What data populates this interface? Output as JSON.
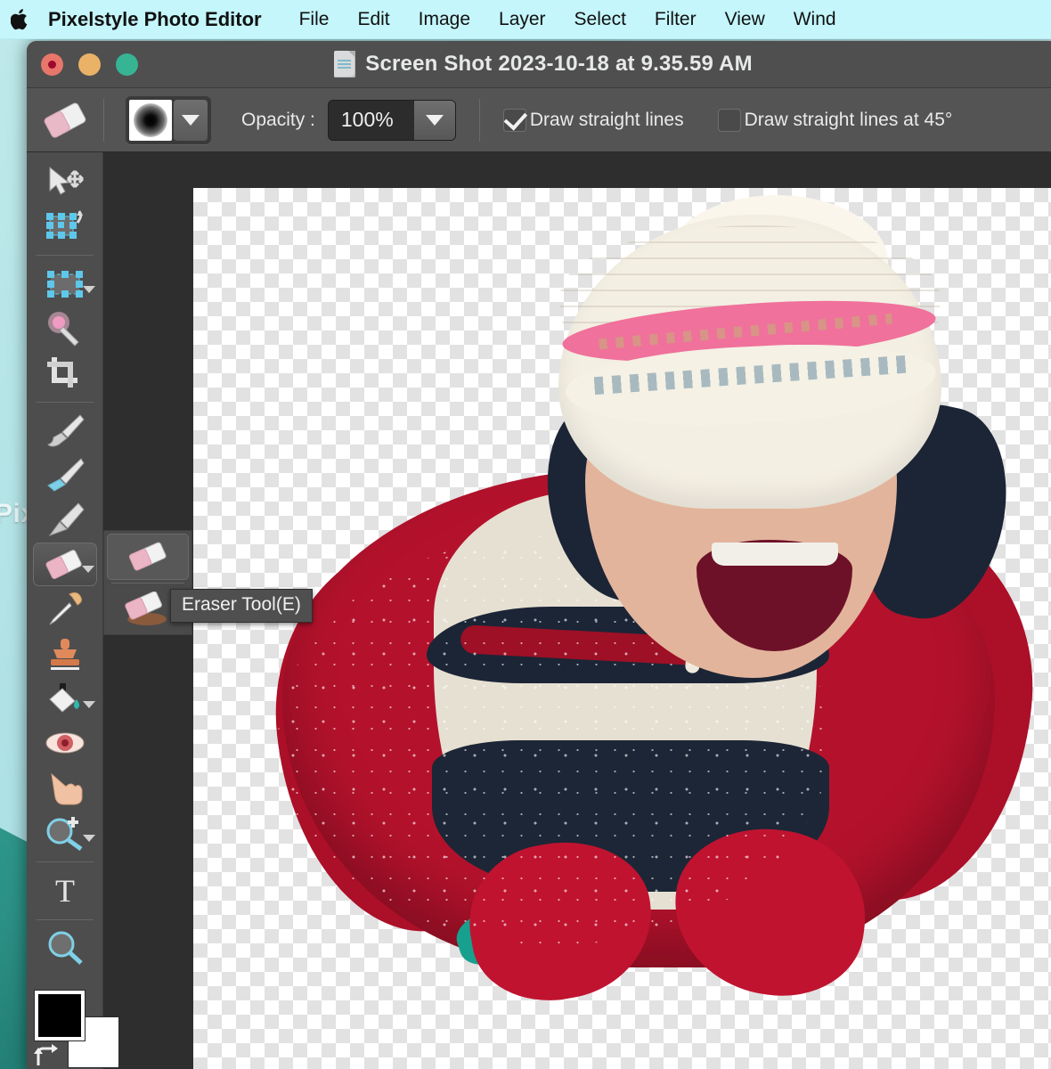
{
  "menubar": {
    "apple_icon": "apple-logo-icon",
    "app_name": "Pixelstyle Photo Editor",
    "items": [
      "File",
      "Edit",
      "Image",
      "Layer",
      "Select",
      "Filter",
      "View",
      "Wind"
    ]
  },
  "desktop": {
    "background_word": "Pix",
    "accent_color": "#c4f6fb"
  },
  "window": {
    "title": "Screen Shot 2023-10-18 at 9.35.59 AM",
    "doc_icon": "document-icon",
    "traffic_lights": {
      "close": "close-button",
      "minimize": "minimize-button",
      "zoom": "zoom-button",
      "close_color": "#e8766b",
      "minimize_color": "#e9b267",
      "zoom_color": "#36b493"
    }
  },
  "options_bar": {
    "active_tool_icon": "eraser-icon",
    "brush_preview": "soft-round-brush-preview",
    "brush_dropdown": "chevron-down-icon",
    "opacity_label": "Opacity :",
    "opacity_value": "100%",
    "opacity_dropdown": "chevron-down-icon",
    "checkboxes": [
      {
        "label": "Draw straight lines",
        "checked": true
      },
      {
        "label": "Draw straight lines at 45°",
        "checked": false
      }
    ]
  },
  "tool_palette": {
    "tools": [
      {
        "name": "move-tool",
        "icon": "arrow-move-icon",
        "has_caret": false,
        "selected": false
      },
      {
        "name": "transform-tool",
        "icon": "transform-icon",
        "has_caret": false,
        "selected": false
      },
      {
        "name": "marquee-select-tool",
        "icon": "marquee-icon",
        "has_caret": true,
        "selected": false
      },
      {
        "name": "magic-wand-tool",
        "icon": "magic-wand-icon",
        "has_caret": false,
        "selected": false
      },
      {
        "name": "crop-tool",
        "icon": "crop-icon",
        "has_caret": false,
        "selected": false
      },
      {
        "name": "brush-tool",
        "icon": "paintbrush-icon",
        "has_caret": false,
        "selected": false
      },
      {
        "name": "smudge-tool",
        "icon": "smudge-brush-icon",
        "has_caret": false,
        "selected": false
      },
      {
        "name": "pencil-tool",
        "icon": "pencil-icon",
        "has_caret": false,
        "selected": false
      },
      {
        "name": "eraser-tool",
        "icon": "eraser-icon",
        "has_caret": true,
        "selected": true
      },
      {
        "name": "eyedropper-tool",
        "icon": "eyedropper-icon",
        "has_caret": false,
        "selected": false
      },
      {
        "name": "clone-stamp-tool",
        "icon": "stamp-icon",
        "has_caret": false,
        "selected": false
      },
      {
        "name": "paint-bucket-tool",
        "icon": "paint-bucket-icon",
        "has_caret": true,
        "selected": false
      },
      {
        "name": "red-eye-tool",
        "icon": "eye-icon",
        "has_caret": false,
        "selected": false
      },
      {
        "name": "hand-tool",
        "icon": "hand-icon",
        "has_caret": false,
        "selected": false
      },
      {
        "name": "zoom-tool",
        "icon": "magnifier-plus-icon",
        "has_caret": true,
        "selected": false
      },
      {
        "name": "text-tool",
        "icon": "text-T-icon",
        "has_caret": false,
        "selected": false
      },
      {
        "name": "search-tool",
        "icon": "magnifier-icon",
        "has_caret": false,
        "selected": false
      }
    ],
    "foreground_color": "#000000",
    "background_color": "#ffffff",
    "swap_icon": "swap-colors-icon"
  },
  "flyout": {
    "items": [
      {
        "name": "eraser-variant-basic",
        "icon": "eraser-icon",
        "selected": true
      },
      {
        "name": "eraser-variant-background",
        "icon": "eraser-bg-icon",
        "selected": false
      }
    ]
  },
  "tooltip": {
    "text": "Eraser Tool(E)"
  },
  "canvas": {
    "checkerboard": "transparency-checkerboard",
    "image_description": "laughing child in white knit hat with pink stripe and red winter jacket"
  }
}
